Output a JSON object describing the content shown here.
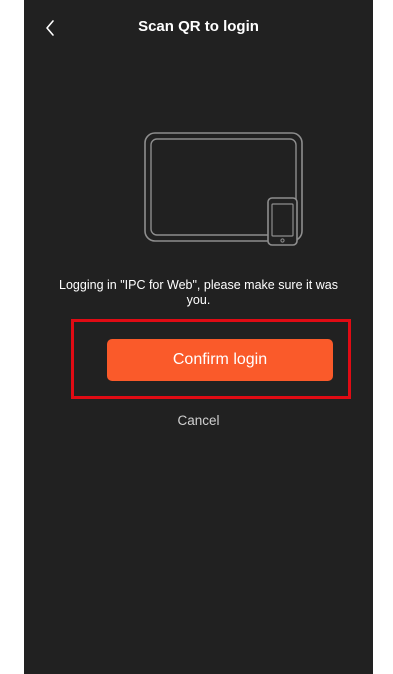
{
  "header": {
    "title": "Scan QR to login",
    "back_icon": "chevron-left-icon"
  },
  "illustration": {
    "icons": [
      "tablet-icon",
      "phone-icon"
    ]
  },
  "message": "Logging in \"IPC for Web\", please make sure it was you.",
  "actions": {
    "confirm_label": "Confirm login",
    "cancel_label": "Cancel"
  },
  "colors": {
    "background": "#212121",
    "accent": "#fa5a2a",
    "highlight": "#e00b14",
    "text": "#ffffff"
  }
}
